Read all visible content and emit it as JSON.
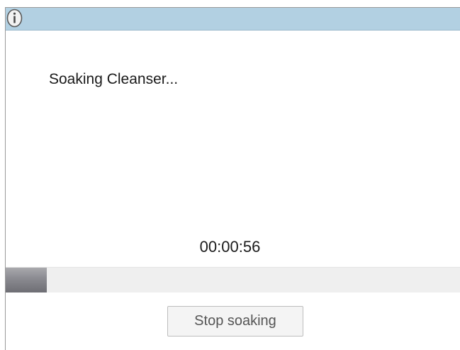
{
  "titlebar": {
    "icon": "info-icon",
    "color": "#b2d0e2"
  },
  "message": "Soaking Cleanser...",
  "timer": "00:00:56",
  "progress": {
    "fraction": 0.09,
    "fill_color": "#7f7f85"
  },
  "stop_button_label": "Stop soaking"
}
